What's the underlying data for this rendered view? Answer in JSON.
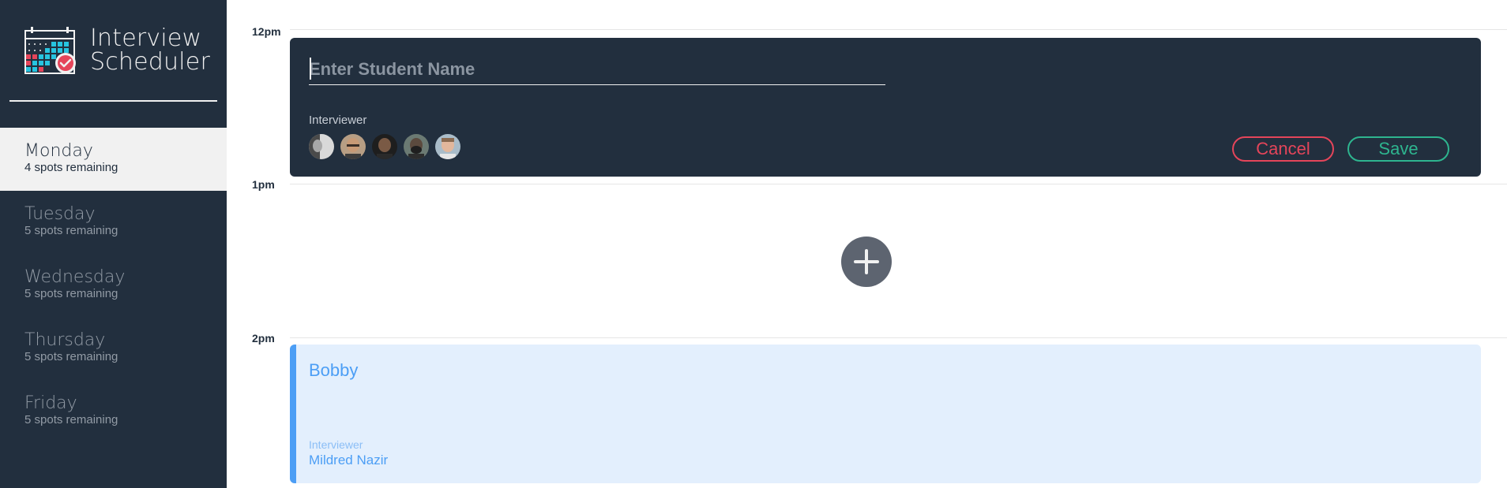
{
  "app": {
    "title_line1": "Interview",
    "title_line2": "Scheduler",
    "logo_icon": "calendar-check-icon"
  },
  "days": [
    {
      "name": "Monday",
      "spots": "4 spots remaining",
      "selected": true
    },
    {
      "name": "Tuesday",
      "spots": "5 spots remaining",
      "selected": false
    },
    {
      "name": "Wednesday",
      "spots": "5 spots remaining",
      "selected": false
    },
    {
      "name": "Thursday",
      "spots": "5 spots remaining",
      "selected": false
    },
    {
      "name": "Friday",
      "spots": "5 spots remaining",
      "selected": false
    }
  ],
  "schedule": {
    "times": [
      "12pm",
      "1pm",
      "2pm"
    ],
    "form": {
      "placeholder": "Enter Student Name",
      "value": "",
      "interviewer_label": "Interviewer",
      "interviewers": [
        "interviewer-avatar-1",
        "interviewer-avatar-2",
        "interviewer-avatar-3",
        "interviewer-avatar-4",
        "interviewer-avatar-5"
      ],
      "cancel_label": "Cancel",
      "save_label": "Save"
    },
    "add_icon": "plus-icon",
    "appointment": {
      "student": "Bobby",
      "interviewer_label": "Interviewer",
      "interviewer_name": "Mildred Nazir"
    }
  },
  "colors": {
    "sidebar_bg": "#222f3e",
    "selected_bg": "#f1f1f1",
    "cancel": "#e5455a",
    "save": "#2eb58f",
    "appointment_accent": "#4c9ef5",
    "appointment_bg": "#e3effd"
  }
}
